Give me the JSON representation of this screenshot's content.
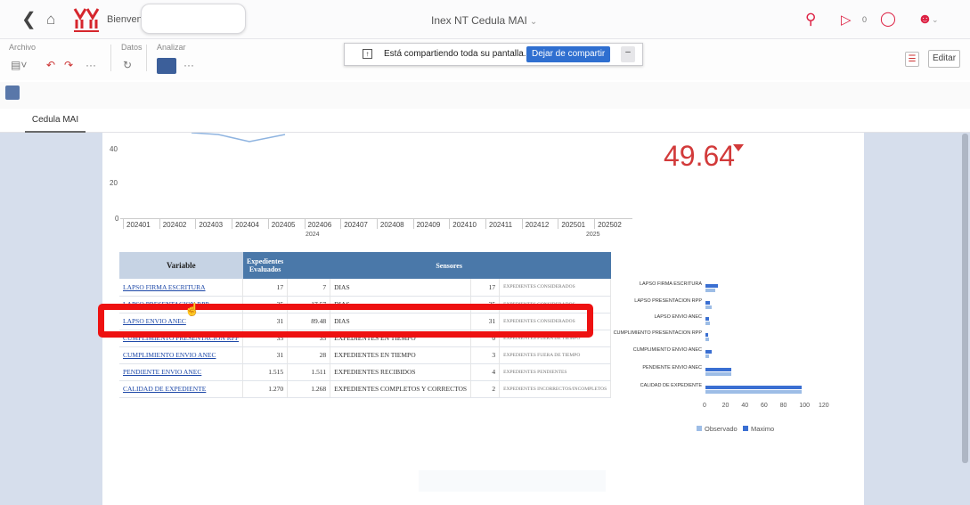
{
  "topbar": {
    "welcome": "Bienvenido:",
    "app_title": "Inex NT Cedula MAI",
    "notif_count": "0"
  },
  "ribbon": {
    "archivo": "Archivo",
    "datos": "Datos",
    "analizar": "Analizar",
    "more": "···",
    "edit_label": "Editar"
  },
  "share_bar": {
    "message": "Está compartiendo toda su pantalla.",
    "stop_label": "Dejar de compartir",
    "min_label": "–"
  },
  "tabs": [
    "Cedula MAI"
  ],
  "line_chart": {
    "y_ticks": [
      "40",
      "20",
      "0"
    ],
    "periods": [
      "202401",
      "202402",
      "202403",
      "202404",
      "202405",
      "202406",
      "202407",
      "202408",
      "202409",
      "202410",
      "202411",
      "202412",
      "202501",
      "202502"
    ],
    "years": [
      "2024",
      "2025"
    ]
  },
  "kpi": {
    "value": "49.64",
    "trend": "down",
    "color": "#d23a3a"
  },
  "table": {
    "headers": {
      "variable": "Variable",
      "evaluados": "Expedientes Evaluados",
      "sensores": "Sensores"
    },
    "rows": [
      {
        "variable": "LAPSO FIRMA ESCRITURA",
        "evaluados": "17",
        "valor": "7",
        "unidad": "DIAS",
        "n": "17",
        "detalle": "EXPEDIENTES CONSIDERADOS"
      },
      {
        "variable": "LAPSO PRESENTACION RPP",
        "evaluados": "35",
        "valor": "17.57",
        "unidad": "DIAS",
        "n": "35",
        "detalle": "EXPEDIENTES CONSIDERADOS"
      },
      {
        "variable": "LAPSO ENVIO ANEC",
        "evaluados": "31",
        "valor": "89.48",
        "unidad": "DIAS",
        "n": "31",
        "detalle": "EXPEDIENTES CONSIDERADOS"
      },
      {
        "variable": "CUMPLIMIENTO PRESENTACION RPP",
        "evaluados": "35",
        "valor": "35",
        "unidad": "EXPEDIENTES EN TIEMPO",
        "n": "0",
        "detalle": "EXPEDIENTES FUERA DE TIEMPO"
      },
      {
        "variable": "CUMPLIMIENTO ENVIO ANEC",
        "evaluados": "31",
        "valor": "28",
        "unidad": "EXPEDIENTES EN TIEMPO",
        "n": "3",
        "detalle": "EXPEDIENTES FUERA DE TIEMPO"
      },
      {
        "variable": "PENDIENTE ENVIO ANEC",
        "evaluados": "1.515",
        "valor": "1.511",
        "unidad": "EXPEDIENTES RECIBIDOS",
        "n": "4",
        "detalle": "EXPEDIENTES PENDIENTES"
      },
      {
        "variable": "CALIDAD DE EXPEDIENTE",
        "evaluados": "1.270",
        "valor": "1.268",
        "unidad": "EXPEDIENTES COMPLETOS Y CORRECTOS",
        "n": "2",
        "detalle": "EXPEDIENTES INCORRECTOS/INCOMPLETOS"
      }
    ]
  },
  "chart_data": {
    "type": "bar",
    "orientation": "horizontal",
    "categories": [
      "LAPSO FIRMA ESCRITURA",
      "LAPSO PRESENTACION RPP",
      "LAPSO ENVIO ANEC",
      "CUMPLIMIENTO PRESENTACION RPP",
      "CUMPLIMIENTO ENVIO ANEC",
      "PENDIENTE ENVIO ANEC",
      "CALIDAD DE EXPEDIENTE"
    ],
    "series": [
      {
        "name": "Observado",
        "color": "#9dbde6",
        "values": [
          10,
          6,
          5,
          4,
          4,
          27,
          100
        ]
      },
      {
        "name": "Maximo",
        "color": "#3a6fd2",
        "values": [
          13,
          5,
          4,
          3,
          6,
          27,
          100
        ]
      }
    ],
    "x_ticks": [
      "0",
      "20",
      "40",
      "60",
      "80",
      "100",
      "120"
    ],
    "xlim": [
      0,
      120
    ],
    "legend": "bottom"
  },
  "colors": {
    "accent": "#d23a3a",
    "header_blue": "#4a78a9",
    "highlight": "#ee1111"
  }
}
